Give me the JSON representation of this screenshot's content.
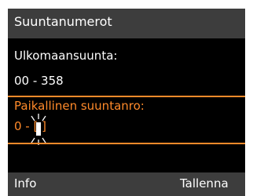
{
  "header": {
    "title": "Suuntanumerot"
  },
  "fields": {
    "international_label": "Ulkomaansuunta:",
    "international_value": "00 - 358",
    "local_label": "Paikallinen suuntanro:",
    "local_value": "0 - [   ]"
  },
  "softkeys": {
    "left": "Info",
    "right": "Tallenna"
  },
  "icons": {
    "cursor": "blinking-cursor-icon"
  },
  "colors": {
    "background": "#000000",
    "bar": "#3d3d3d",
    "accent": "#ff8a2a",
    "text": "#ffffff"
  }
}
